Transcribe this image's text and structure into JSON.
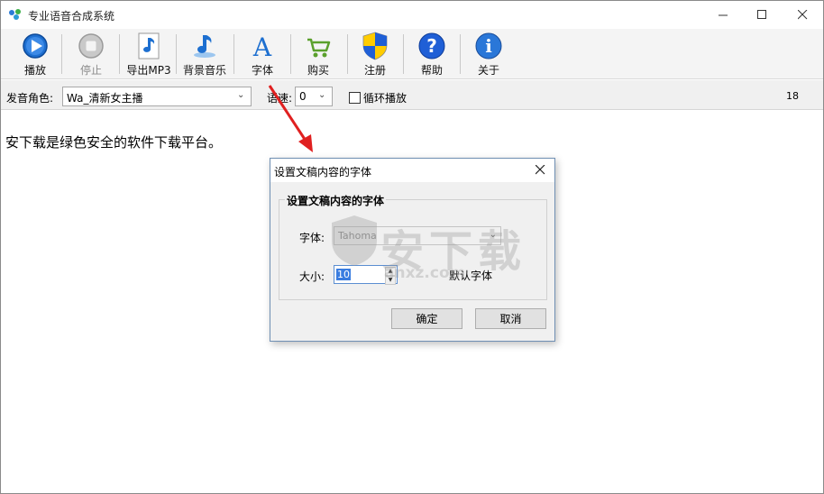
{
  "window": {
    "title": "专业语音合成系统",
    "controls": [
      "minimize",
      "maximize",
      "close"
    ]
  },
  "toolbar": [
    {
      "label": "播放",
      "icon": "play-icon",
      "enabled": true
    },
    {
      "label": "停止",
      "icon": "stop-icon",
      "enabled": false
    },
    {
      "label": "导出MP3",
      "icon": "music-note-icon",
      "enabled": true
    },
    {
      "label": "背景音乐",
      "icon": "background-music-icon",
      "enabled": true
    },
    {
      "label": "字体",
      "icon": "font-icon",
      "enabled": true
    },
    {
      "label": "购买",
      "icon": "cart-icon",
      "enabled": true
    },
    {
      "label": "注册",
      "icon": "shield-icon",
      "enabled": true
    },
    {
      "label": "帮助",
      "icon": "help-icon",
      "enabled": true
    },
    {
      "label": "关于",
      "icon": "info-icon",
      "enabled": true
    }
  ],
  "options": {
    "voice_label": "发音角色:",
    "voice_value": "Wa_清新女主播",
    "speed_label": "语速:",
    "speed_value": "0",
    "loop_label": "循环播放",
    "loop_checked": false,
    "right_value": "18"
  },
  "content": {
    "text": "安下载是绿色安全的软件下载平台。"
  },
  "dialog": {
    "title": "设置文稿内容的字体",
    "group_title": "设置文稿内容的字体",
    "font_label": "字体:",
    "font_value": "Tahoma",
    "size_label": "大小:",
    "size_value": "10",
    "default_font_label": "默认字体",
    "ok_label": "确定",
    "cancel_label": "取消"
  },
  "watermark": {
    "main": "安下载",
    "sub": "anxz.com"
  },
  "colors": {
    "annotation_arrow": "#e02020",
    "dialog_border": "#6f8fb3",
    "play_icon": "#1e6fd0",
    "help_icon": "#1f5fd6"
  }
}
